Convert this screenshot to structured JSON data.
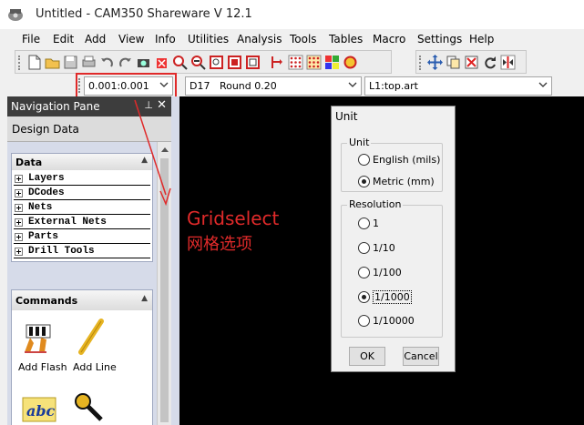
{
  "window": {
    "title": "Untitled - CAM350 Shareware V 12.1"
  },
  "menu": [
    "File",
    "Edit",
    "Add",
    "View",
    "Info",
    "Utilities",
    "Analysis",
    "Tools",
    "Tables",
    "Macro",
    "Settings",
    "Help"
  ],
  "toolbar": {
    "icons": [
      "new-file-icon",
      "open-folder-icon",
      "save-icon",
      "print-icon",
      "undo-icon",
      "redo-icon",
      "camera-icon",
      "delete-icon",
      "zoom-in-icon",
      "zoom-out-icon",
      "zoom-window-icon",
      "zoom-fit-icon",
      "zoom-all-icon",
      "snap-icon",
      "grid-icon",
      "grid-dots-icon",
      "layer-color-icon",
      "paint-icon",
      "move-icon",
      "copy-icon",
      "delete-x-icon",
      "rotate-icon",
      "mirror-icon"
    ]
  },
  "combos": {
    "grid": "0.001:0.001",
    "dcode": "D17   Round 0.20",
    "layer": "L1:top.art"
  },
  "nav": {
    "title": "Navigation Pane",
    "pin": "⊥",
    "close": "✕",
    "design_tab": "Design Data",
    "data_header": "Data",
    "data_items": [
      "Layers",
      "DCodes",
      "Nets",
      "External Nets",
      "Parts",
      "Drill Tools"
    ],
    "commands_header": "Commands",
    "commands": [
      {
        "label": "Add Flash",
        "icon": "add-flash-icon"
      },
      {
        "label": "Add Line",
        "icon": "add-line-icon"
      }
    ]
  },
  "annotation": {
    "english": "Gridselect",
    "chinese": "网格选项",
    "color": "#e02a2a"
  },
  "dialog": {
    "title": "Unit",
    "unit_group": "Unit",
    "unit_options": [
      {
        "label": "English (mils)",
        "checked": false
      },
      {
        "label": "Metric (mm)",
        "checked": true
      }
    ],
    "resolution_group": "Resolution",
    "resolution_options": [
      {
        "label": "1",
        "checked": false
      },
      {
        "label": "1/10",
        "checked": false
      },
      {
        "label": "1/100",
        "checked": false
      },
      {
        "label": "1/1000",
        "checked": true
      },
      {
        "label": "1/10000",
        "checked": false
      }
    ],
    "ok": "OK",
    "cancel": "Cancel"
  }
}
